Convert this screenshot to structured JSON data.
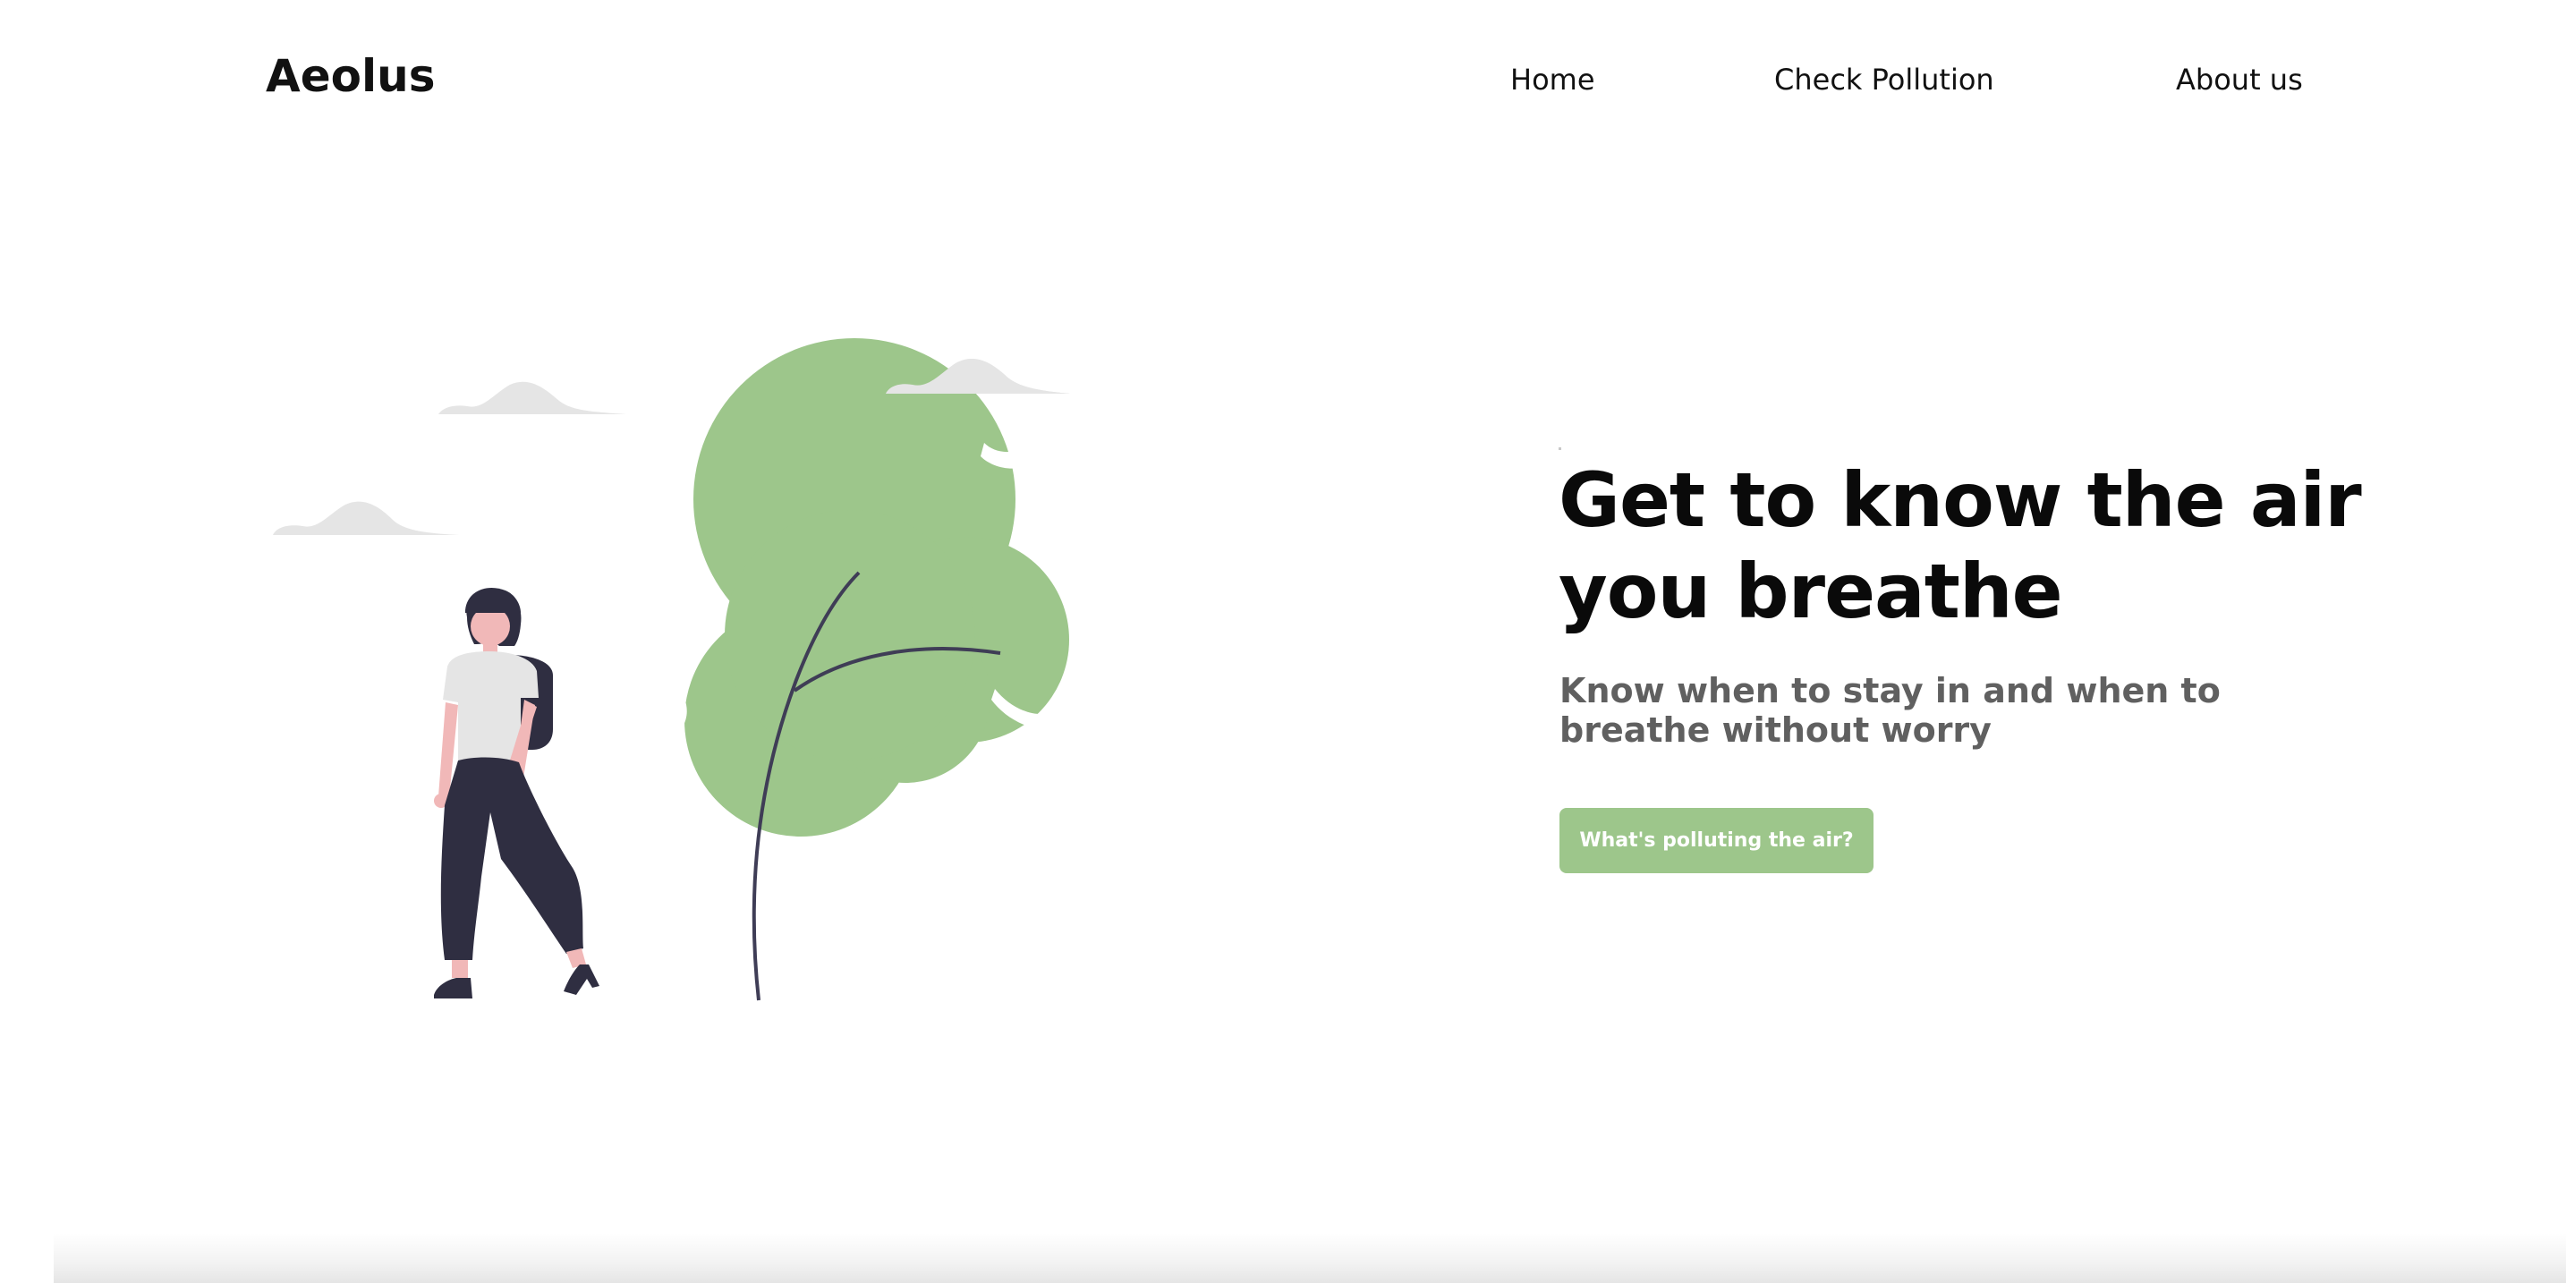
{
  "header": {
    "brand": "Aeolus",
    "nav": [
      {
        "label": "Home"
      },
      {
        "label": "Check Pollution"
      },
      {
        "label": "About us"
      }
    ]
  },
  "hero": {
    "title": "Get to know the air you breathe",
    "subtitle": "Know when to stay in and when to breathe without worry",
    "cta_label": "What's polluting the air?"
  },
  "colors": {
    "accent": "#9dc68b",
    "text": "#111111",
    "subtext": "#606060",
    "cloud": "#e5e5e5",
    "figure_dark": "#2f2e41",
    "skin": "#f1b8b8"
  },
  "illustration": {
    "icon": "woman-tree-wind-illustration"
  }
}
